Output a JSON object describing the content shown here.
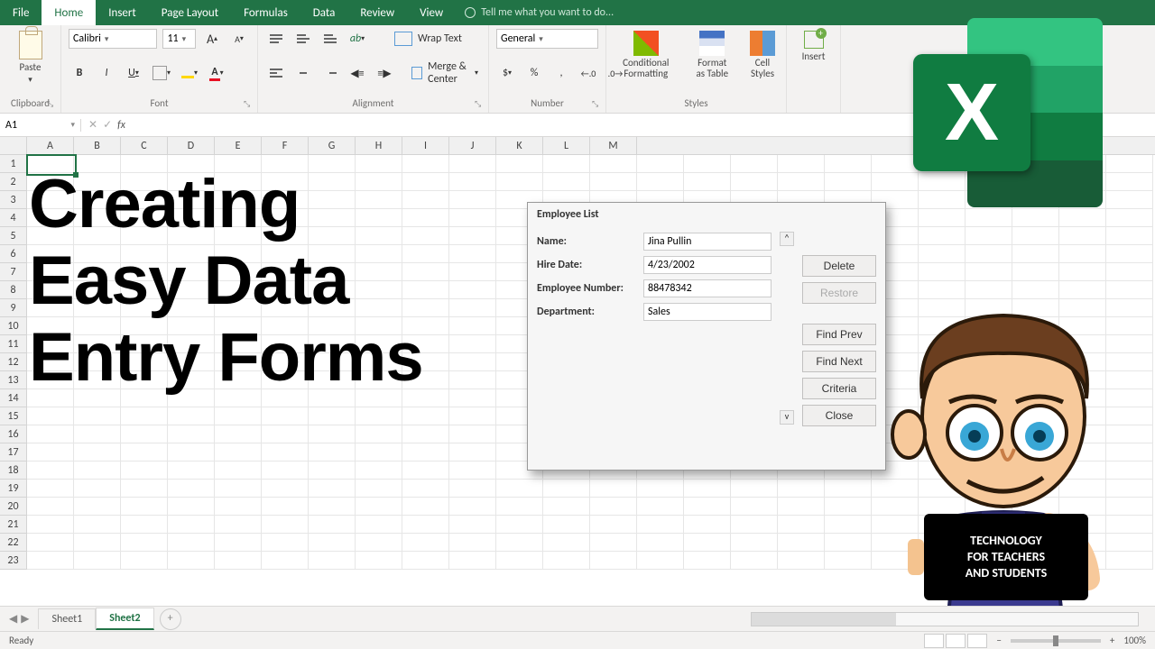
{
  "tabs": {
    "file": "File",
    "home": "Home",
    "insert": "Insert",
    "page_layout": "Page Layout",
    "formulas": "Formulas",
    "data": "Data",
    "review": "Review",
    "view": "View",
    "tell_me": "Tell me what you want to do..."
  },
  "ribbon": {
    "clipboard": {
      "label": "Clipboard",
      "paste": "Paste"
    },
    "font": {
      "label": "Font",
      "family": "Calibri",
      "size": "11",
      "bold": "B",
      "italic": "I",
      "underline": "U",
      "increase": "A",
      "decrease": "A",
      "color_letter": "A"
    },
    "alignment": {
      "label": "Alignment",
      "wrap": "Wrap Text",
      "merge": "Merge & Center"
    },
    "number": {
      "label": "Number",
      "format": "General",
      "currency": "$",
      "percent": "%",
      "comma": ",",
      "inc_dec": "←.0",
      "dec_dec": ".0→"
    },
    "styles": {
      "label": "Styles",
      "conditional": "Conditional Formatting",
      "format_table": "Format as Table",
      "cell_styles": "Cell Styles"
    },
    "cells": {
      "insert": "Insert"
    }
  },
  "namebox": "A1",
  "columns": [
    "A",
    "B",
    "C",
    "D",
    "E",
    "F",
    "G",
    "H",
    "I",
    "J",
    "K",
    "L",
    "M"
  ],
  "rows": [
    "1",
    "2",
    "3",
    "4",
    "5",
    "6",
    "7",
    "8",
    "9",
    "10",
    "11",
    "12",
    "13",
    "14",
    "15",
    "16",
    "17",
    "18",
    "19",
    "20",
    "21",
    "22",
    "23"
  ],
  "headline": {
    "l1": "Creating",
    "l2": "Easy Data",
    "l3": "Entry Forms"
  },
  "dialog": {
    "title": "Employee List",
    "fields": {
      "name": {
        "label": "Name:",
        "value": "Jina Pullin"
      },
      "hire": {
        "label": "Hire Date:",
        "value": "4/23/2002"
      },
      "emp": {
        "label": "Employee Number:",
        "value": "88478342"
      },
      "dept": {
        "label": "Department:",
        "value": "Sales"
      }
    },
    "buttons": {
      "delete": "Delete",
      "restore": "Restore",
      "findprev": "Find Prev",
      "findnext": "Find Next",
      "criteria": "Criteria",
      "close": "Close"
    }
  },
  "sheets": {
    "s1": "Sheet1",
    "s2": "Sheet2"
  },
  "status": {
    "ready": "Ready",
    "zoom": "100%"
  },
  "sign": {
    "l": "TECHNOLOGY\nFOR TEACHERS\nAND STUDENTS"
  },
  "logo": "X"
}
